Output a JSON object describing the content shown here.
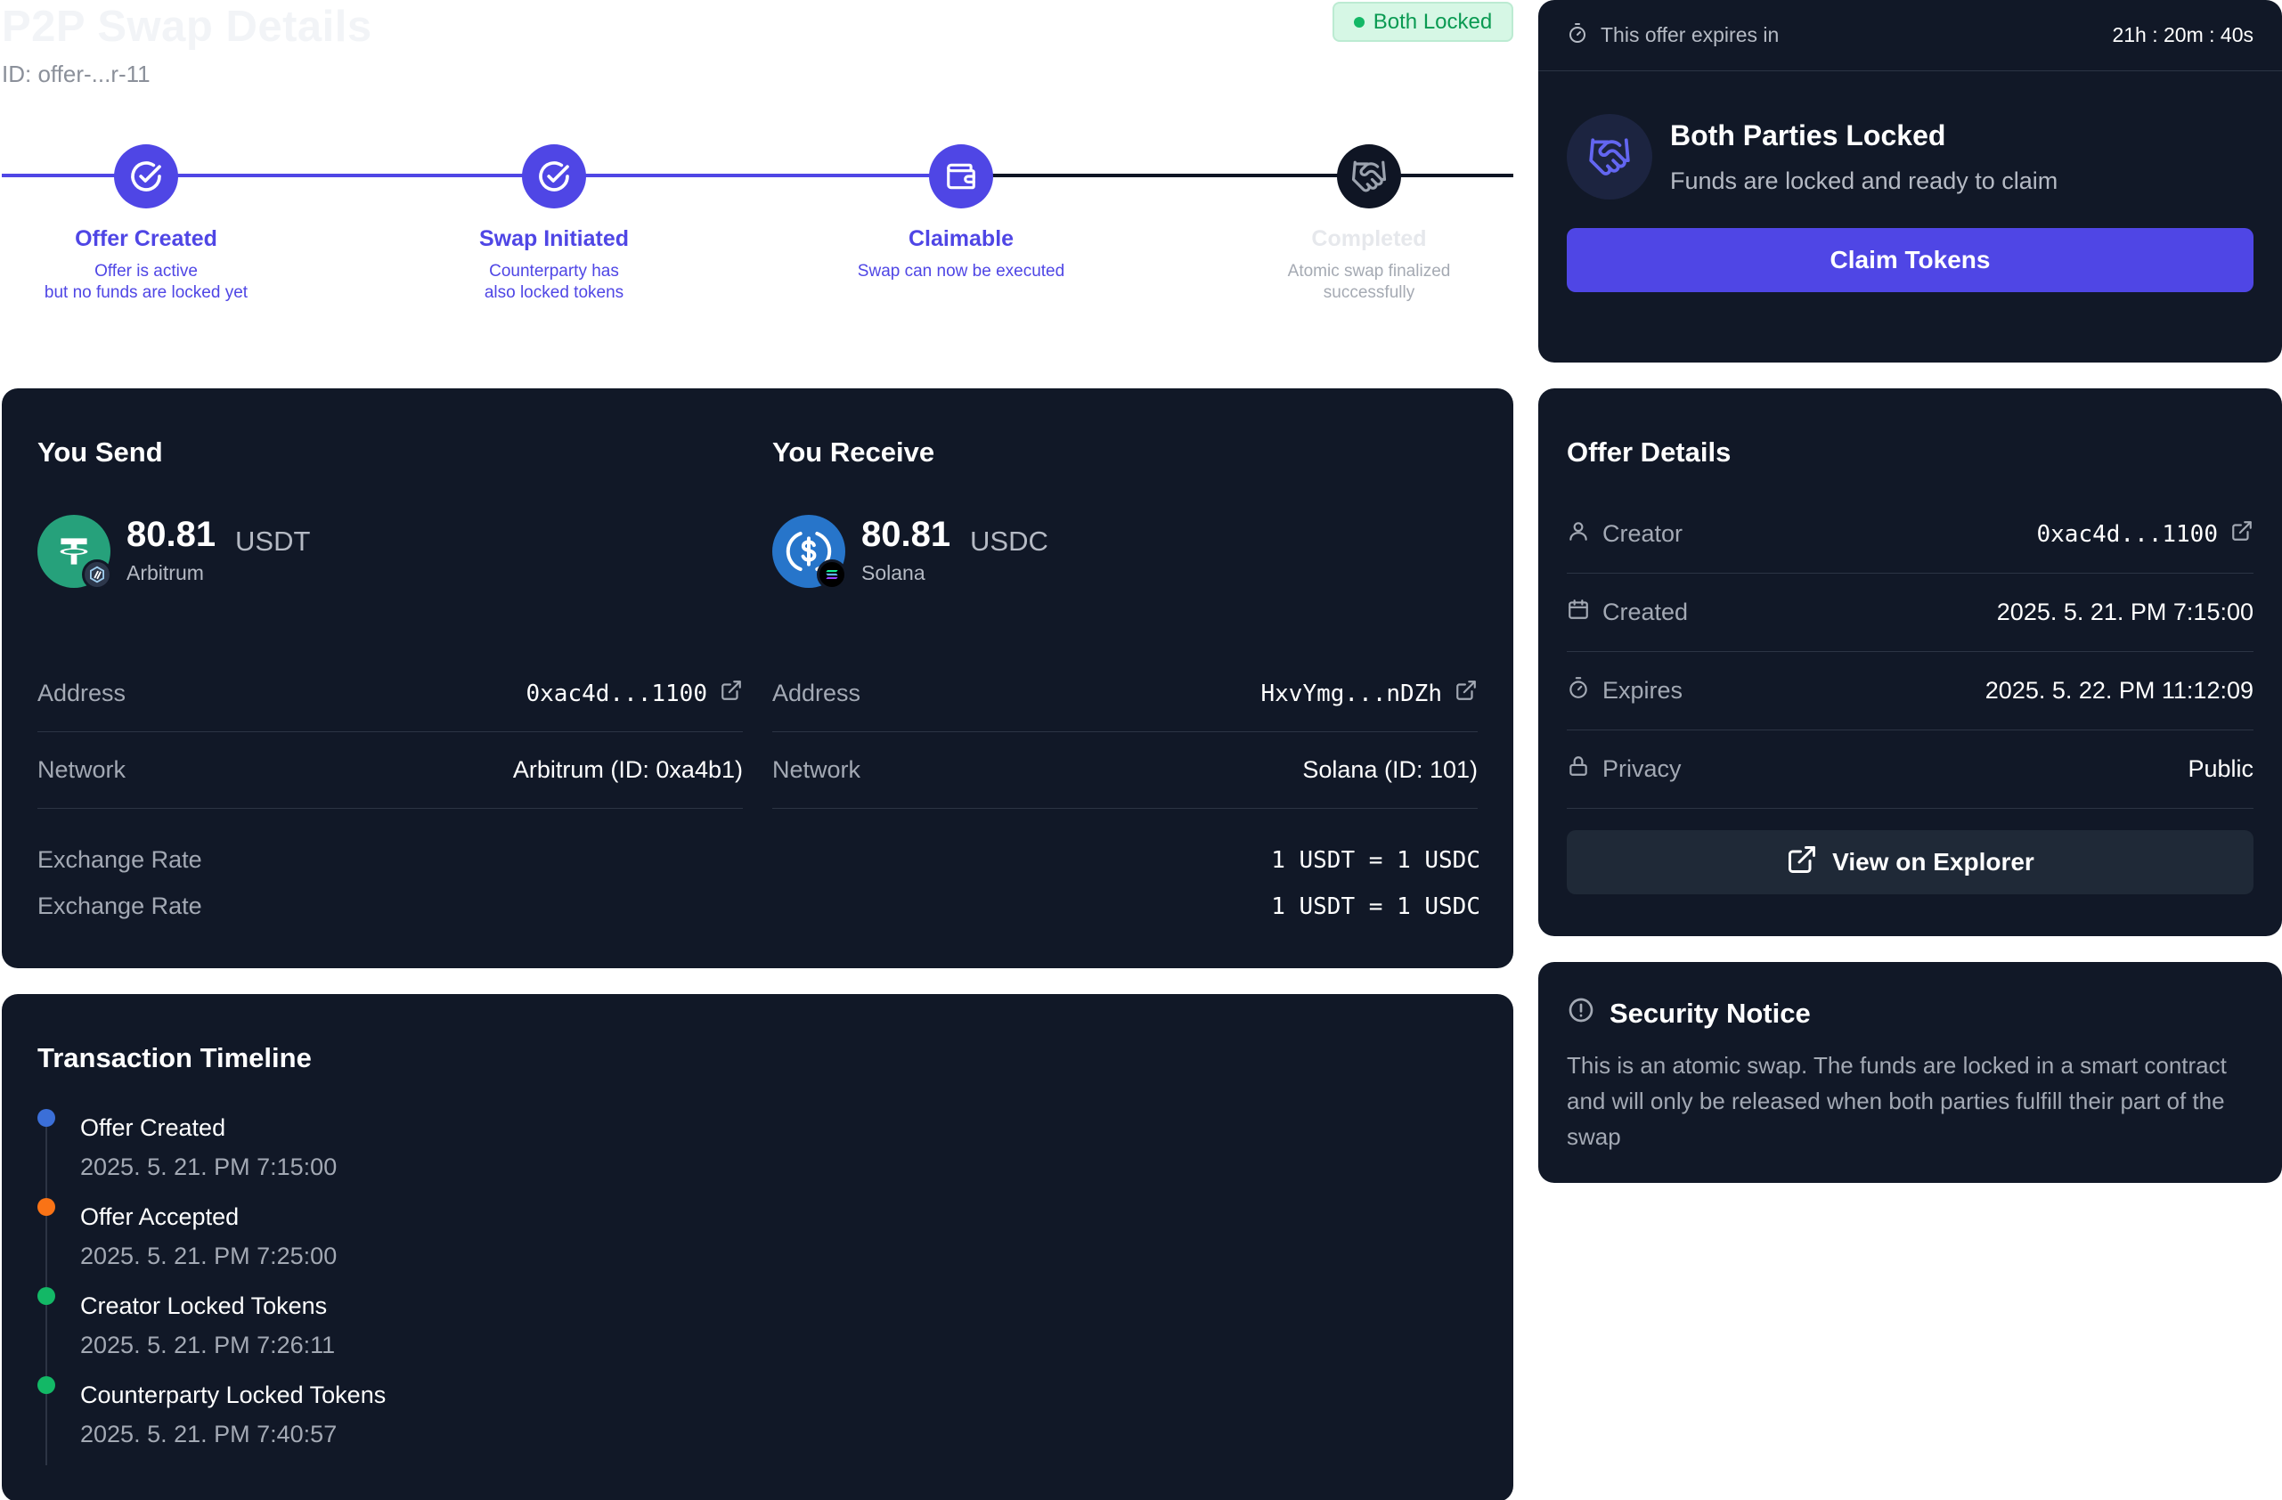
{
  "header": {
    "title": "P2P Swap Details",
    "offer_id": "ID: offer-...r-11",
    "status_badge": "Both Locked"
  },
  "colors": {
    "accent": "#4f46e5",
    "card_bg": "#111827",
    "success": "#13b866",
    "orange": "#f97316",
    "blue": "#3b6fd8"
  },
  "stepper": {
    "steps": [
      {
        "title": "Offer Created",
        "desc_line1": "Offer is active",
        "desc_line2": "but no funds are locked yet",
        "icon": "check-circle-icon",
        "state": "done"
      },
      {
        "title": "Swap Initiated",
        "desc_line1": "Counterparty has",
        "desc_line2": "also locked tokens",
        "icon": "check-circle-icon",
        "state": "done"
      },
      {
        "title": "Claimable",
        "desc_line1": "Swap can now be executed",
        "desc_line2": "",
        "icon": "wallet-icon",
        "state": "current"
      },
      {
        "title": "Completed",
        "desc_line1": "Atomic swap finalized",
        "desc_line2": "successfully",
        "icon": "handshake-icon",
        "state": "pending"
      }
    ]
  },
  "send": {
    "title": "You Send",
    "amount": "80.81",
    "symbol": "USDT",
    "chain": "Arbitrum",
    "address_label": "Address",
    "address": "0xac4d...1100",
    "network_label": "Network",
    "network": "Arbitrum (ID: 0xa4b1)"
  },
  "receive": {
    "title": "You Receive",
    "amount": "80.81",
    "symbol": "USDC",
    "chain": "Solana",
    "address_label": "Address",
    "address": "HxvYmg...nDZh",
    "network_label": "Network",
    "network": "Solana (ID: 101)"
  },
  "rates": [
    {
      "label": "Exchange Rate",
      "value": "1 USDT = 1 USDC"
    },
    {
      "label": "Exchange Rate",
      "value": "1 USDT = 1 USDC"
    }
  ],
  "timeline": {
    "title": "Transaction Timeline",
    "events": [
      {
        "name": "Offer Created",
        "time": "2025. 5. 21. PM 7:15:00",
        "color": "#3b6fd8"
      },
      {
        "name": "Offer Accepted",
        "time": "2025. 5. 21. PM 7:25:00",
        "color": "#f97316"
      },
      {
        "name": "Creator Locked Tokens",
        "time": "2025. 5. 21. PM 7:26:11",
        "color": "#13b866"
      },
      {
        "name": "Counterparty Locked Tokens",
        "time": "2025. 5. 21. PM 7:40:57",
        "color": "#13b866"
      }
    ]
  },
  "expiry": {
    "label": "This offer expires in",
    "remaining": "21h : 20m : 40s",
    "state_title": "Both Parties Locked",
    "state_subtitle": "Funds are locked and ready to claim",
    "claim_label": "Claim Tokens"
  },
  "details": {
    "title": "Offer Details",
    "rows": [
      {
        "label": "Creator",
        "value": "0xac4d...1100",
        "icon": "user-icon"
      },
      {
        "label": "Created",
        "value": "2025. 5. 21. PM 7:15:00",
        "icon": "calendar-icon"
      },
      {
        "label": "Expires",
        "value": "2025. 5. 22. PM 11:12:09",
        "icon": "timer-icon"
      },
      {
        "label": "Privacy",
        "value": "Public",
        "icon": "lock-icon"
      }
    ],
    "explorer_label": "View on Explorer"
  },
  "security": {
    "title": "Security Notice",
    "body": "This is an atomic swap. The funds are locked in a smart contract and will only be released when both parties fulfill their part of the swap"
  }
}
